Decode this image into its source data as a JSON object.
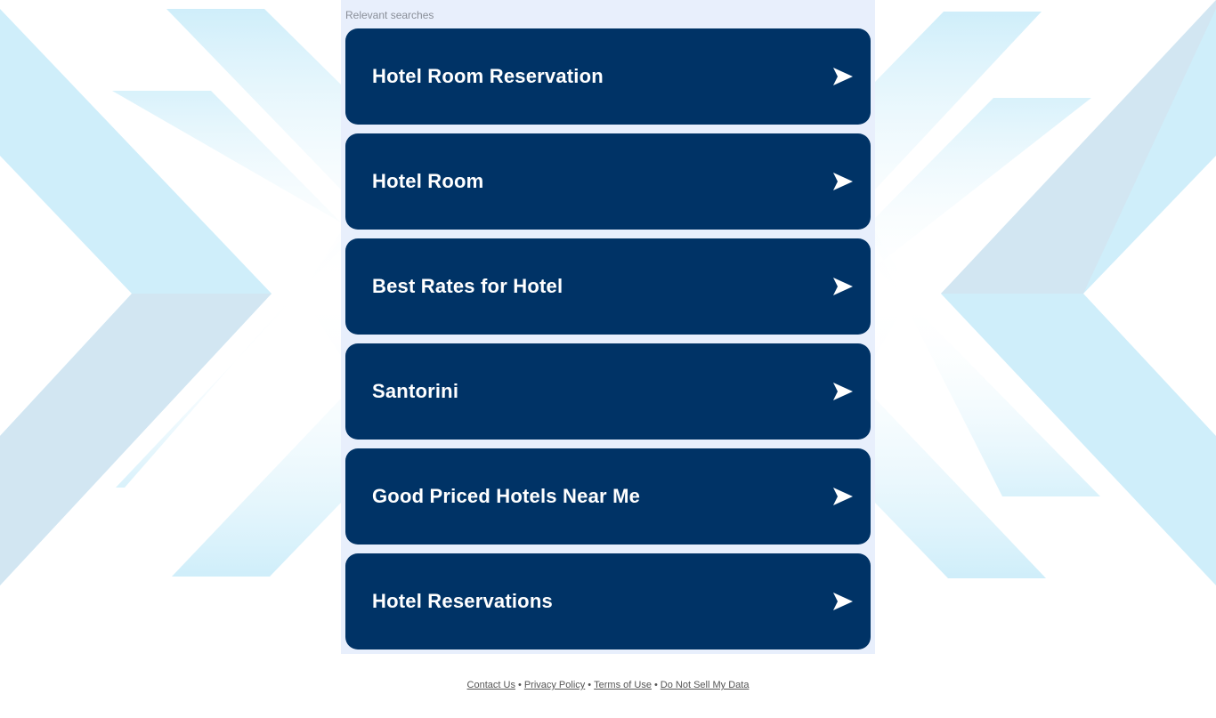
{
  "panel": {
    "heading": "Relevant searches"
  },
  "results": [
    {
      "label": "Hotel Room Reservation"
    },
    {
      "label": "Hotel Room"
    },
    {
      "label": "Best Rates for Hotel"
    },
    {
      "label": "Santorini"
    },
    {
      "label": "Good Priced Hotels Near Me"
    },
    {
      "label": "Hotel Reservations"
    }
  ],
  "footer": {
    "links": [
      {
        "label": "Contact Us"
      },
      {
        "label": "Privacy Policy"
      },
      {
        "label": "Terms of Use"
      },
      {
        "label": "Do Not Sell My Data"
      }
    ],
    "separator": "•"
  },
  "colors": {
    "result_background": "#003366",
    "result_text": "#ffffff",
    "panel_background": "#e8effc",
    "background_shapes": [
      "#cfeefa",
      "#d2e6f2"
    ]
  },
  "icons": {
    "result_arrow": "arrow-right-icon",
    "background": "chevron-pattern"
  }
}
